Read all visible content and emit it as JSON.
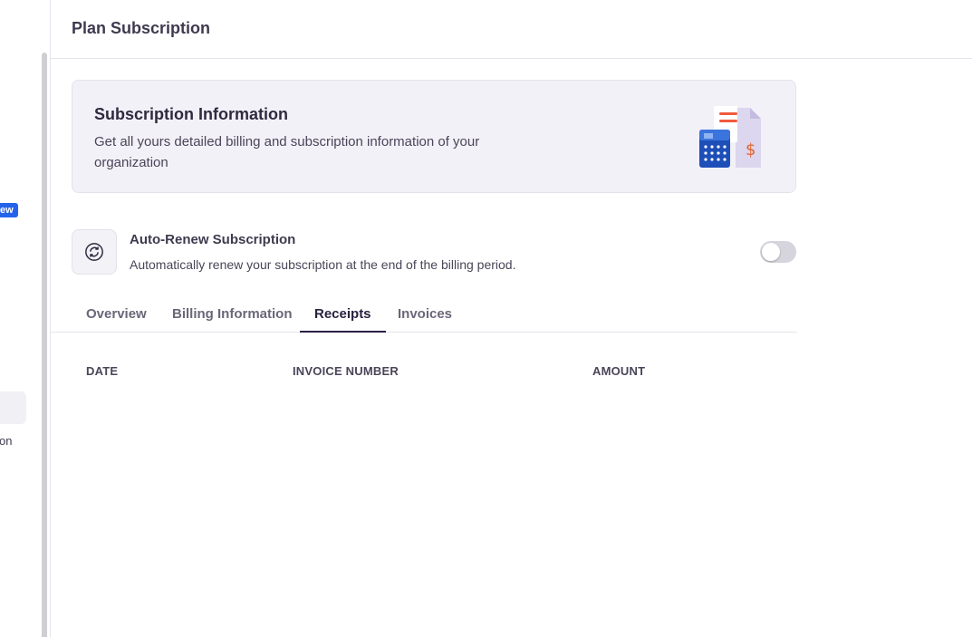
{
  "sidebar": {
    "badge_text": "ew",
    "partial_label": "on"
  },
  "header": {
    "title": "Plan Subscription"
  },
  "info_card": {
    "title": "Subscription Information",
    "description": "Get all yours detailed billing and subscription information of your organization",
    "illustration_icon": "calculator-invoice-icon"
  },
  "auto_renew": {
    "icon": "refresh-icon",
    "title": "Auto-Renew Subscription",
    "description": "Automatically renew your subscription at the end of the billing period.",
    "enabled": false
  },
  "tabs": [
    {
      "label": "Overview",
      "active": false
    },
    {
      "label": "Billing Information",
      "active": false
    },
    {
      "label": "Receipts",
      "active": true
    },
    {
      "label": "Invoices",
      "active": false
    }
  ],
  "table": {
    "columns": [
      "DATE",
      "INVOICE NUMBER",
      "AMOUNT"
    ],
    "rows": []
  },
  "colors": {
    "accent": "#2a1f45",
    "badge": "#2563eb",
    "card_bg": "#f3f1f8"
  }
}
